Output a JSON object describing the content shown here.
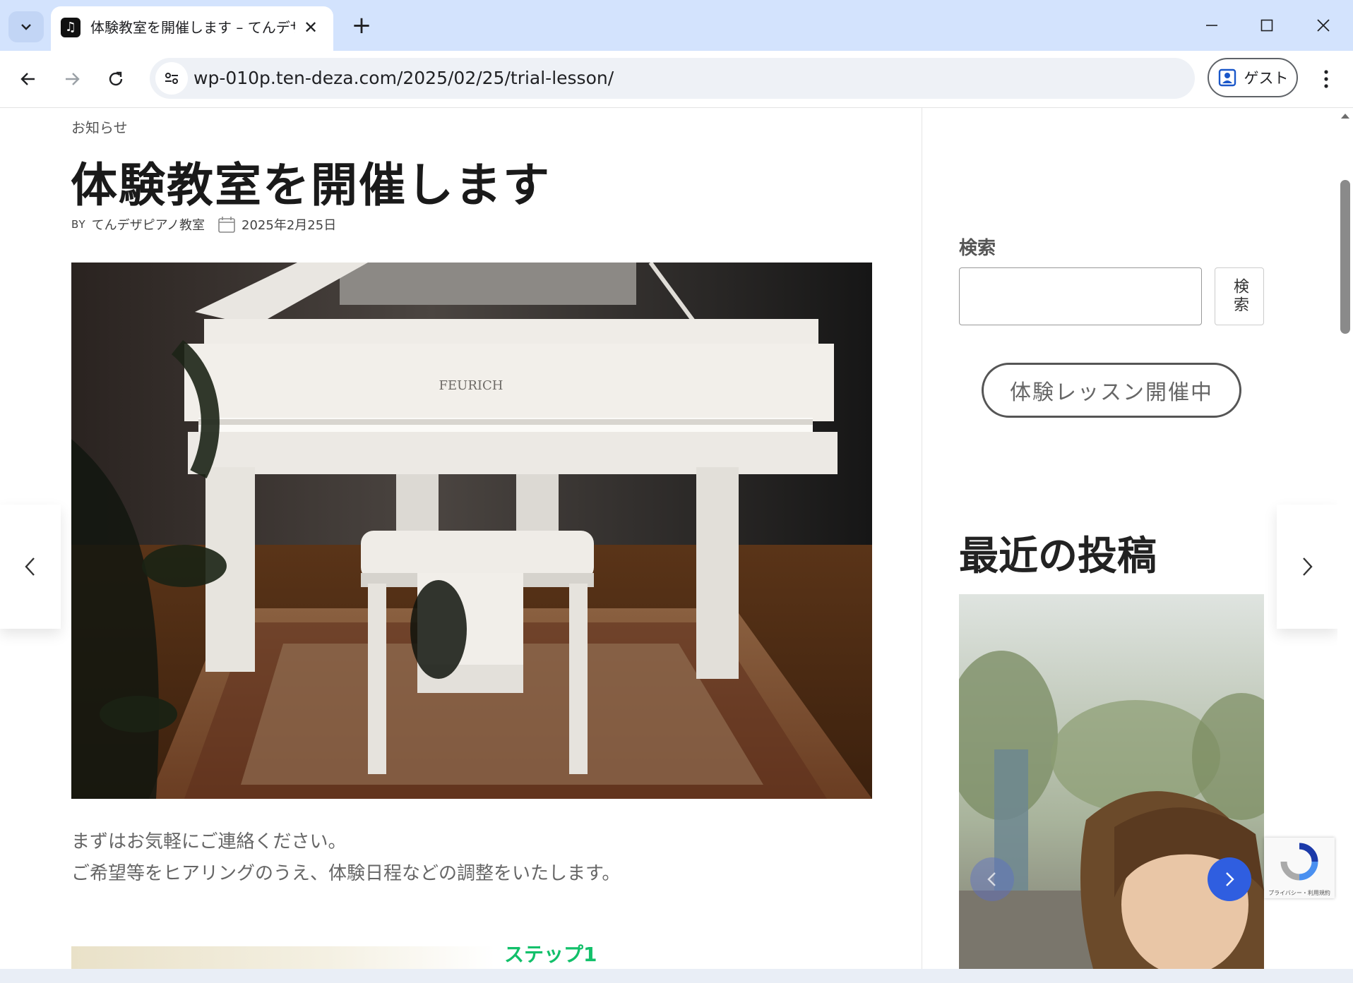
{
  "browser": {
    "tab_title": "体験教室を開催します – てんデザピアノ教室",
    "url": "wp-010p.ten-deza.com/2025/02/25/trial-lesson/",
    "profile_label": "ゲスト"
  },
  "post": {
    "category": "お知らせ",
    "title": "体験教室を開催します",
    "by_label": "BY",
    "author": "てんデザピアノ教室",
    "date": "2025年2月25日",
    "hero_brand": "FEURICH",
    "body_line1": "まずはお気軽にご連絡ください。",
    "body_line2": "ご希望等をヒアリングのうえ、体験日程などの調整をいたします。",
    "step_heading": "ステップ1"
  },
  "sidebar": {
    "search_label": "検索",
    "search_value": "",
    "search_button": "検索",
    "trial_button": "体験レッスン開催中",
    "recent_title": "最近の投稿"
  },
  "recaptcha": {
    "text": "プライバシー・利用規約"
  },
  "icons": {
    "back": "arrow-left-icon",
    "forward": "arrow-right-icon",
    "reload": "reload-icon",
    "site_info": "tune-icon",
    "profile": "person-icon",
    "menu": "kebab-menu-icon",
    "calendar": "calendar-icon"
  }
}
